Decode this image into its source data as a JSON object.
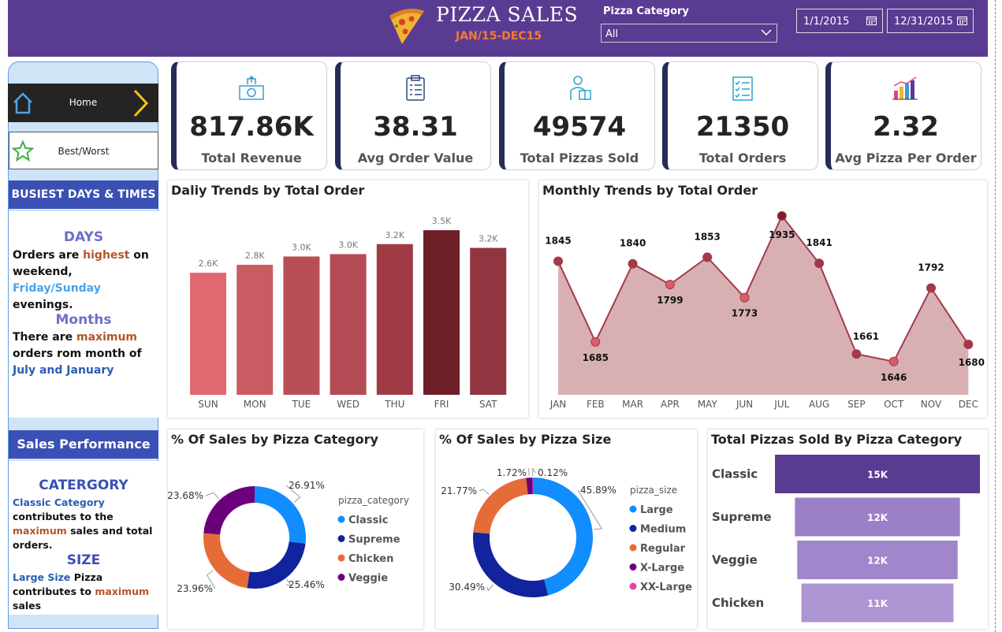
{
  "header": {
    "title": "PIZZA SALES",
    "subtitle": "JAN/15-DEC15",
    "slicer_label": "Pizza Category",
    "slicer_value": "All",
    "start_date": "1/1/2015",
    "end_date": "12/31/2015"
  },
  "nav": {
    "home": "Home",
    "best_worst": "Best/Worst"
  },
  "insights": {
    "busiest_title": "BUSIEST DAYS & TIMES",
    "days_head": "DAYS",
    "days_p1": "Orders are ",
    "days_hi": "highest",
    "days_p2": " on weekend, ",
    "days_days": "Friday/Sunday",
    "days_p3": " evenings.",
    "months_head": "Months",
    "months_p1": "There are ",
    "months_hi": "maximum",
    "months_p2": " orders rom month of ",
    "months_months": "July and January",
    "perf_title": "Sales Performance",
    "cat_head": "CATERGORY",
    "cat_p1": "Classic Category",
    "cat_p2": " contributes to the ",
    "cat_hi": "maximum",
    "cat_p3": " sales and total orders.",
    "size_head": "SIZE",
    "size_p1": "Large Size",
    "size_p2": " Pizza contributes to ",
    "size_hi": "maximum",
    "size_p3": " sales"
  },
  "kpis": [
    {
      "value": "817.86K",
      "label": "Total Revenue",
      "icon": "money-icon"
    },
    {
      "value": "38.31",
      "label": "Avg Order Value",
      "icon": "clipboard-icon"
    },
    {
      "value": "49574",
      "label": "Total Pizzas Sold",
      "icon": "delivery-icon"
    },
    {
      "value": "21350",
      "label": "Total Orders",
      "icon": "checklist-icon"
    },
    {
      "value": "2.32",
      "label": "Avg Pizza Per Order",
      "icon": "bar-chart-icon"
    }
  ],
  "chart_data": [
    {
      "type": "bar",
      "title": "Daliy Trends by Total Order",
      "categories": [
        "SUN",
        "MON",
        "TUE",
        "WED",
        "THU",
        "FRI",
        "SAT"
      ],
      "values": [
        2624,
        2794,
        2973,
        3024,
        3239,
        3538,
        3158
      ],
      "labels": [
        "2.6K",
        "2.8K",
        "3.0K",
        "3.0K",
        "3.2K",
        "3.5K",
        "3.2K"
      ],
      "colors": [
        "#e06870",
        "#c95c63",
        "#b84f57",
        "#b24b53",
        "#a03b46",
        "#6e1f28",
        "#913641"
      ],
      "ylim": [
        0,
        3540
      ]
    },
    {
      "type": "area",
      "title": "Monthly Trends by Total Order",
      "categories": [
        "JAN",
        "FEB",
        "MAR",
        "APR",
        "MAY",
        "JUN",
        "JUL",
        "AUG",
        "SEP",
        "OCT",
        "NOV",
        "DEC"
      ],
      "values": [
        1845,
        1685,
        1840,
        1799,
        1853,
        1773,
        1935,
        1841,
        1661,
        1646,
        1792,
        1680
      ],
      "ylim": [
        1580,
        1935
      ]
    },
    {
      "type": "pie",
      "title": "% Of Sales by Pizza Category",
      "legend_title": "pizza_category",
      "categories": [
        "Classic",
        "Supreme",
        "Chicken",
        "Veggie"
      ],
      "values": [
        26.91,
        25.46,
        23.96,
        23.68
      ],
      "labels": [
        "26.91%",
        "25.46%",
        "23.96%",
        "23.68%"
      ],
      "colors": [
        "#118dff",
        "#12239e",
        "#e66c37",
        "#6b007b"
      ]
    },
    {
      "type": "pie",
      "title": "% Of Sales by Pizza Size",
      "legend_title": "pizza_size",
      "categories": [
        "Large",
        "Medium",
        "Regular",
        "X-Large",
        "XX-Large"
      ],
      "values": [
        45.89,
        30.49,
        21.77,
        1.72,
        0.12
      ],
      "labels": [
        "45.89%",
        "30.49%",
        "21.77%",
        "1.72%",
        "0.12%"
      ],
      "colors": [
        "#118dff",
        "#12239e",
        "#e66c37",
        "#6b007b",
        "#e044a7"
      ]
    },
    {
      "type": "bar",
      "title": "Total Pizzas Sold By Pizza Category",
      "categories": [
        "Classic",
        "Supreme",
        "Veggie",
        "Chicken"
      ],
      "values": [
        14888,
        11987,
        11649,
        11050
      ],
      "labels": [
        "15K",
        "12K",
        "12K",
        "11K"
      ],
      "colors": [
        "#5a3b92",
        "#9b80c8",
        "#a186cb",
        "#ad95d4"
      ]
    }
  ]
}
